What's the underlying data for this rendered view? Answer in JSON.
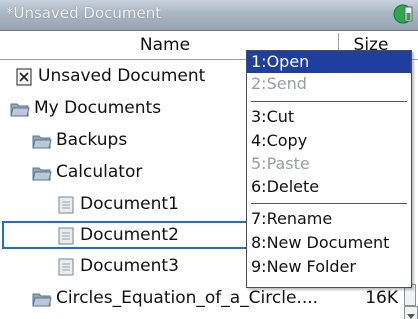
{
  "window": {
    "title": "*Unsaved Document"
  },
  "header": {
    "name_col": "Name",
    "size_col": "Size"
  },
  "rows": [
    {
      "label": "Unsaved Document",
      "icon": "unsaved-document-icon",
      "size": ""
    },
    {
      "label": "My Documents",
      "icon": "folder-open-icon",
      "size": ""
    },
    {
      "label": "Backups",
      "icon": "folder-icon",
      "size": ""
    },
    {
      "label": "Calculator",
      "icon": "folder-icon",
      "size": ""
    },
    {
      "label": "Document1",
      "icon": "document-icon",
      "size": ""
    },
    {
      "label": "Document2",
      "icon": "document-icon",
      "size": ""
    },
    {
      "label": "Document3",
      "icon": "document-icon",
      "size": ""
    },
    {
      "label": "Circles_Equation_of_a_Circle....",
      "icon": "folder-icon",
      "size": "16K"
    }
  ],
  "menu": {
    "items": [
      {
        "label": "1:Open",
        "state": "active"
      },
      {
        "label": "2:Send",
        "state": "disabled"
      },
      {
        "label": "3:Cut",
        "state": "enabled"
      },
      {
        "label": "4:Copy",
        "state": "enabled"
      },
      {
        "label": "5:Paste",
        "state": "disabled"
      },
      {
        "label": "6:Delete",
        "state": "enabled"
      },
      {
        "label": "7:Rename",
        "state": "enabled"
      },
      {
        "label": "8:New Document",
        "state": "enabled"
      },
      {
        "label": "9:New Folder",
        "state": "enabled"
      }
    ]
  },
  "colors": {
    "selection_border": "#1b6ed2",
    "menu_highlight": "#1f3f9e",
    "title_bar": "#a7b3c1"
  }
}
